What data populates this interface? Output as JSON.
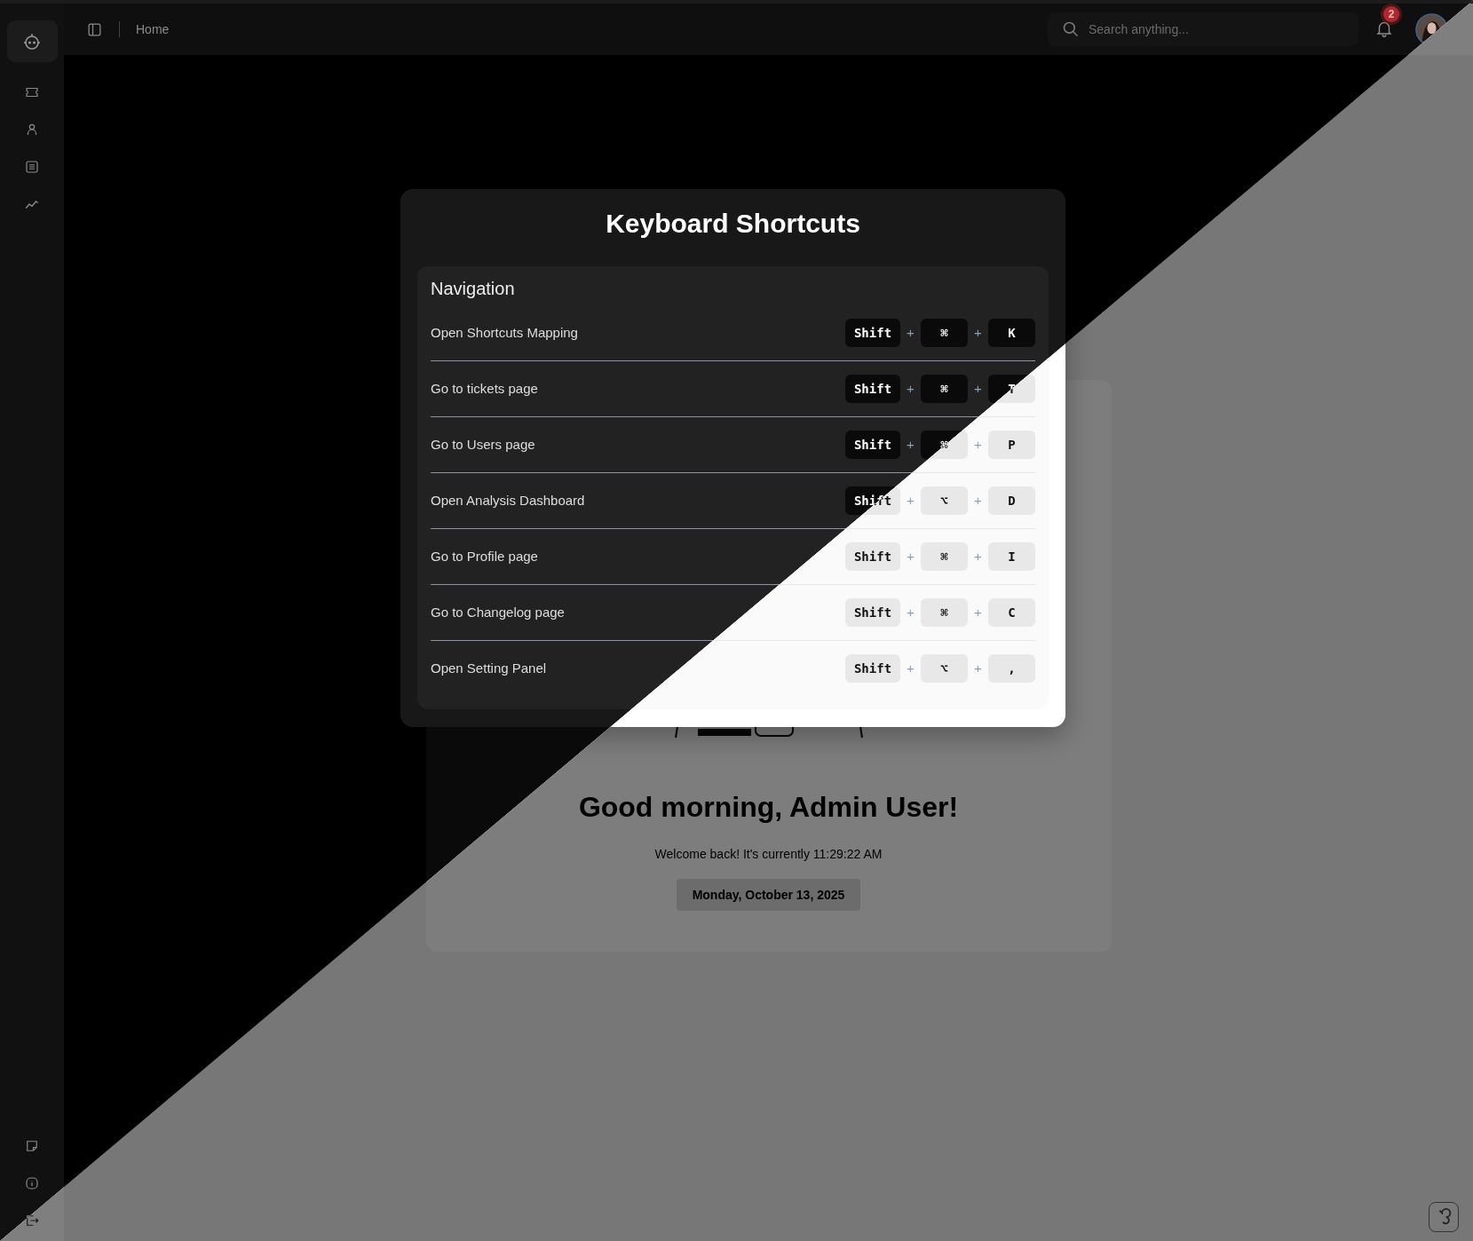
{
  "top_bar": {
    "breadcrumb": "Home",
    "search": {
      "placeholder": "Search anything..."
    },
    "notifications": {
      "badge": "2"
    }
  },
  "shortcuts_dialog": {
    "title": "Keyboard Shortcuts",
    "section": "Navigation",
    "shortcuts": [
      {
        "label": "Open Shortcuts Mapping",
        "keys": [
          "Shift",
          "⌘",
          "K"
        ],
        "separators": [
          "+",
          "+"
        ]
      },
      {
        "label": "Go to tickets page",
        "keys": [
          "Shift",
          "⌘",
          "T"
        ],
        "separators": [
          "+",
          "+"
        ]
      },
      {
        "label": "Go to Users page",
        "keys": [
          "Shift",
          "⌘",
          "P"
        ],
        "separators": [
          "+",
          "+"
        ]
      },
      {
        "label": "Open Analysis Dashboard",
        "keys": [
          "Shift",
          "⌥",
          "D"
        ],
        "separators": [
          "+",
          "+"
        ]
      },
      {
        "label": "Go to Profile page",
        "keys": [
          "Shift",
          "⌘",
          "I"
        ],
        "separators": [
          "+",
          "+"
        ]
      },
      {
        "label": "Go to Changelog page",
        "keys": [
          "Shift",
          "⌘",
          "C"
        ],
        "separators": [
          "+",
          "+"
        ]
      },
      {
        "label": "Open Setting Panel",
        "keys": [
          "Shift",
          "⌥",
          ","
        ],
        "separators": [
          "+",
          "+"
        ]
      }
    ]
  },
  "greeting": {
    "heading": "Good morning, Admin User!",
    "subtitle": "Welcome back! It's currently 11:29:22 AM",
    "date": "Monday, October 13, 2025"
  }
}
